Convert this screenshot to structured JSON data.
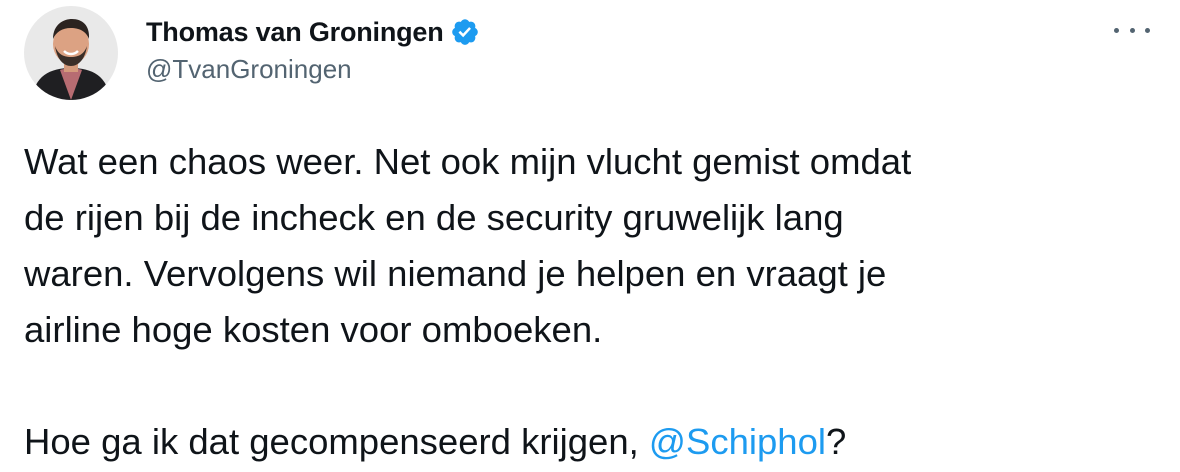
{
  "author": {
    "display_name": "Thomas van Groningen",
    "handle": "@TvanGroningen",
    "verified": true,
    "verified_icon": "verified-badge-icon"
  },
  "more_icon": "more-options-icon",
  "tweet": {
    "lines": [
      "Wat een chaos weer. Net ook mijn vlucht gemist omdat",
      "de rijen bij de incheck en de security gruwelijk lang",
      "waren. Vervolgens wil niemand je helpen en vraagt je",
      "airline hoge kosten voor omboeken."
    ],
    "question_prefix": "Hoe ga ik dat gecompenseerd krijgen, ",
    "mention": "@Schiphol",
    "question_suffix": "?"
  },
  "colors": {
    "text": "#0f1419",
    "secondary": "#536471",
    "accent": "#1d9bf0"
  }
}
